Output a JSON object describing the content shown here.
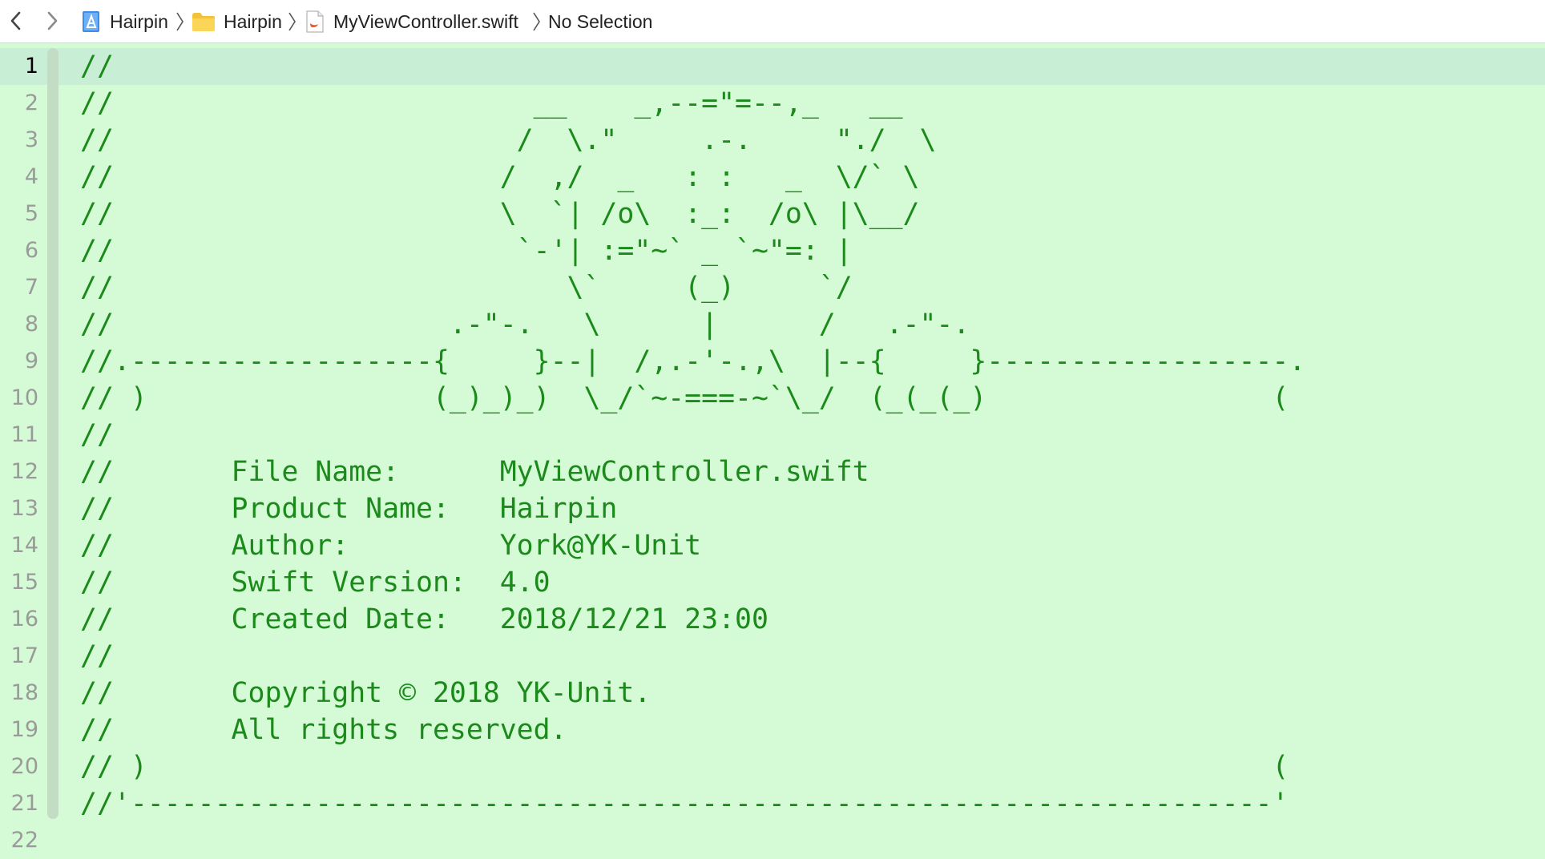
{
  "jumpbar": {
    "back_label": "<",
    "forward_label": ">",
    "crumbs": [
      {
        "label": "Hairpin",
        "icon": "project-icon"
      },
      {
        "label": "Hairpin",
        "icon": "folder-icon"
      },
      {
        "label": "MyViewController.swift",
        "icon": "swift-file-icon"
      },
      {
        "label": "No Selection",
        "icon": ""
      }
    ]
  },
  "editor": {
    "active_line": 1,
    "line_numbers": [
      "1",
      "2",
      "3",
      "4",
      "5",
      "6",
      "7",
      "8",
      "9",
      "10",
      "11",
      "12",
      "13",
      "14",
      "15",
      "16",
      "17",
      "18",
      "19",
      "20",
      "21",
      "22"
    ],
    "lines": [
      "//",
      "//                         __    _,--=\"=--,_   __",
      "//                        /  \\.\"     .-.     \"./  \\",
      "//                       /  ,/  _   : :   _  \\/` \\",
      "//                       \\  `| /o\\  :_:  /o\\ |\\__/",
      "//                        `-'| :=\"~` _ `~\"=: |",
      "//                           \\`     (_)     `/",
      "//                    .-\"-.   \\      |      /   .-\"-.",
      "//.------------------{     }--|  /,.-'-.,\\  |--{     }------------------.",
      "// )                 (_)_)_)  \\_/`~-===-~`\\_/  (_(_(_)                 (",
      "//",
      "//       File Name:      MyViewController.swift",
      "//       Product Name:   Hairpin",
      "//       Author:         York@YK-Unit",
      "//       Swift Version:  4.0",
      "//       Created Date:   2018/12/21 23:00",
      "//",
      "//       Copyright © 2018 YK-Unit.",
      "//       All rights reserved.",
      "// )                                                                   (",
      "//'--------------------------------------------------------------------'",
      ""
    ]
  },
  "colors": {
    "editor_background": "#d5fad6",
    "current_line": "#c8efd6",
    "comment_text": "#1b8a1b",
    "line_number": "#9a9a9a"
  }
}
